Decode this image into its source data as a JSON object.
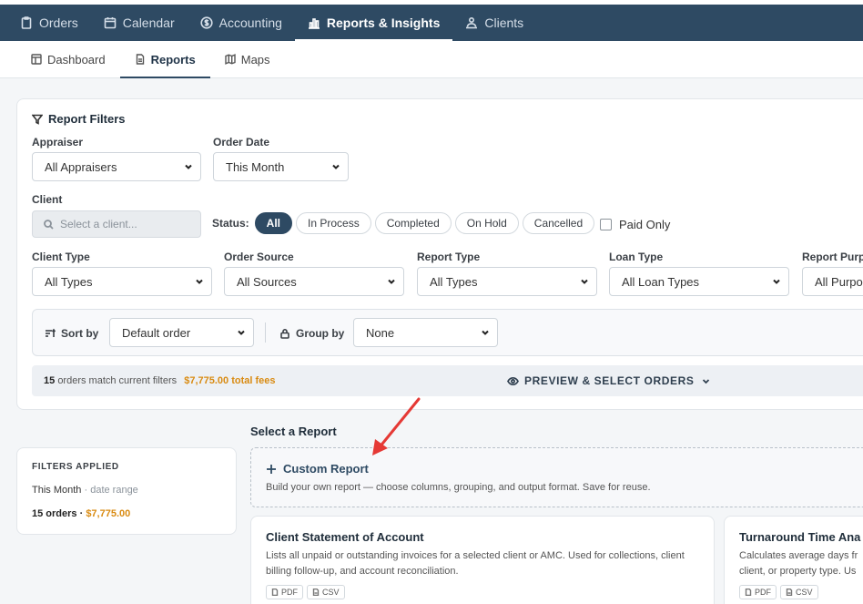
{
  "topnav": {
    "items": [
      {
        "label": "Orders",
        "icon": "clipboard-icon"
      },
      {
        "label": "Calendar",
        "icon": "calendar-icon"
      },
      {
        "label": "Accounting",
        "icon": "dollar-icon"
      },
      {
        "label": "Reports & Insights",
        "icon": "bar-chart-icon",
        "active": true
      },
      {
        "label": "Clients",
        "icon": "users-icon"
      }
    ]
  },
  "subnav": {
    "items": [
      {
        "label": "Dashboard",
        "icon": "dashboard-icon"
      },
      {
        "label": "Reports",
        "icon": "document-icon",
        "active": true
      },
      {
        "label": "Maps",
        "icon": "map-icon"
      }
    ]
  },
  "filters": {
    "title": "Report Filters",
    "appraiser": {
      "label": "Appraiser",
      "value": "All Appraisers"
    },
    "order_date": {
      "label": "Order Date",
      "value": "This Month"
    },
    "client": {
      "label": "Client",
      "placeholder": "Select a client..."
    },
    "status": {
      "label": "Status:",
      "options": [
        "All",
        "In Process",
        "Completed",
        "On Hold",
        "Cancelled"
      ]
    },
    "paid_only": "Paid Only",
    "client_type": {
      "label": "Client Type",
      "value": "All Types"
    },
    "order_source": {
      "label": "Order Source",
      "value": "All Sources"
    },
    "report_type": {
      "label": "Report Type",
      "value": "All Types"
    },
    "loan_type": {
      "label": "Loan Type",
      "value": "All Loan Types"
    },
    "report_purpose": {
      "label": "Report Purpo",
      "value": "All Purpos"
    },
    "sort_by": {
      "label": "Sort by",
      "value": "Default order"
    },
    "group_by": {
      "label": "Group by",
      "value": "None"
    },
    "match": {
      "count": "15",
      "text": "orders match current filters",
      "fees": "$7,775.00 total fees"
    },
    "preview": "PREVIEW & SELECT ORDERS"
  },
  "applied": {
    "heading": "FILTERS APPLIED",
    "date_value": "This Month",
    "date_sub": "· date range",
    "orders": "15 orders",
    "sep": " · ",
    "fee": "$7,775.00"
  },
  "reports": {
    "heading": "Select a Report",
    "custom": {
      "title": "Custom Report",
      "desc": "Build your own report — choose columns, grouping, and output format. Save for reuse."
    },
    "cards": [
      {
        "title": "Client Statement of Account",
        "desc": "Lists all unpaid or outstanding invoices for a selected client or AMC. Used for collections, client billing follow-up, and account reconciliation.",
        "tags": [
          "PDF",
          "CSV"
        ]
      },
      {
        "title": "Turnaround Time Ana",
        "desc": "Calculates average days fr client, or property type. Us",
        "tags": [
          "PDF",
          "CSV"
        ]
      }
    ]
  }
}
